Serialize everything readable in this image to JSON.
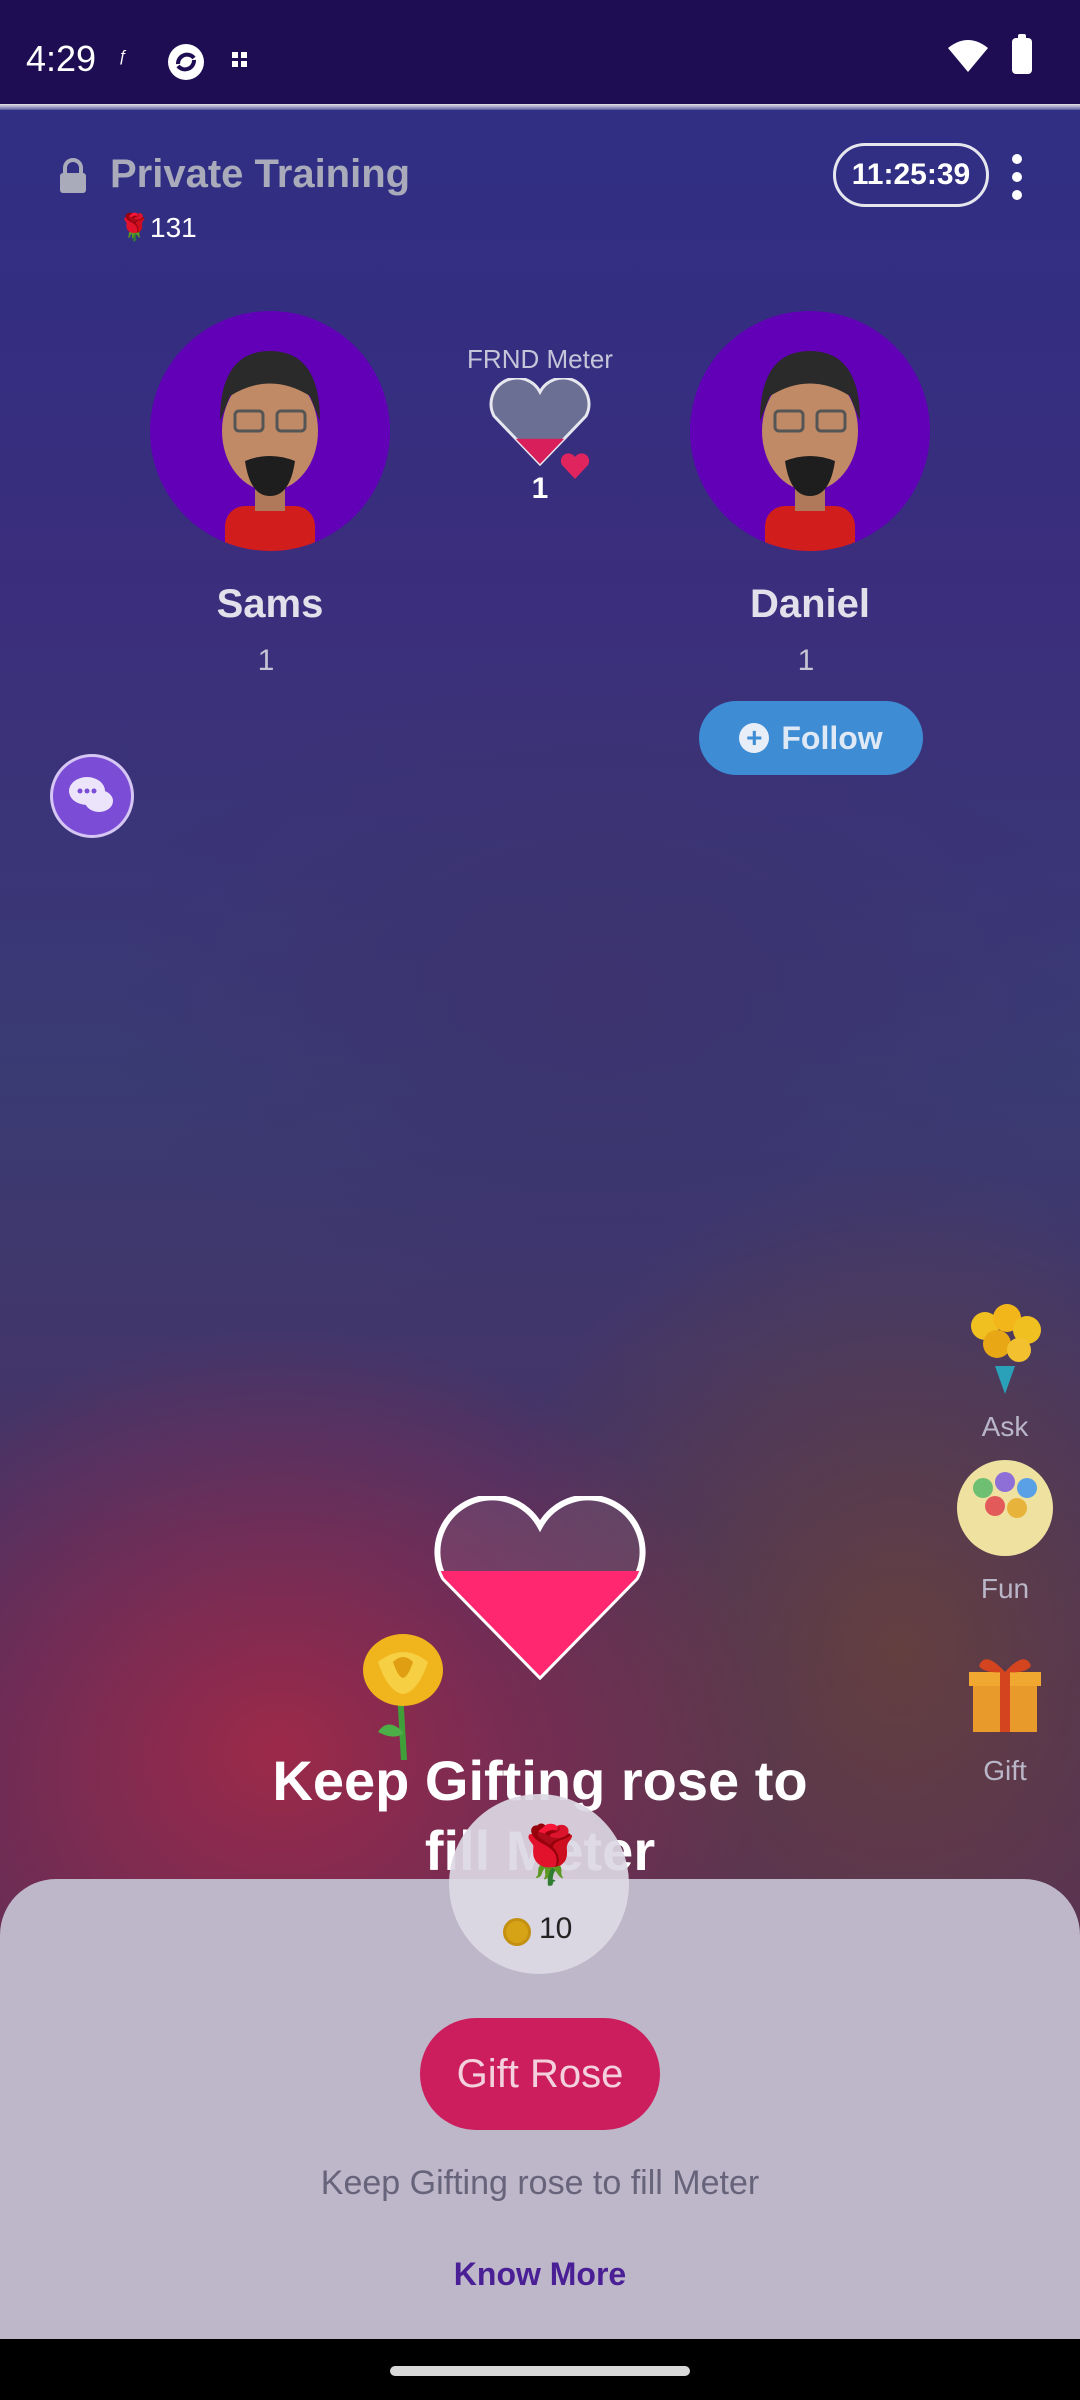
{
  "status_bar": {
    "time": "4:29",
    "notification_icons": [
      "frnd-app-icon",
      "sync-icon",
      "grid-icon"
    ]
  },
  "room": {
    "title": "Private Training",
    "rose_count": "131",
    "timer": "11:25:39"
  },
  "meter": {
    "label": "FRND Meter",
    "count": "1",
    "fill_fraction": 0.35
  },
  "users": [
    {
      "name": "Sams",
      "count": "1"
    },
    {
      "name": "Daniel",
      "count": "1",
      "follow_label": "Follow"
    }
  ],
  "side_actions": [
    {
      "label": "Ask",
      "icon": "bouquet-icon"
    },
    {
      "label": "Fun",
      "icon": "lottery-balls-icon"
    },
    {
      "label": "Gift",
      "icon": "gift-box-icon"
    }
  ],
  "promo": {
    "heading": "Keep Gifting rose to fill Meter",
    "big_heart_fill_fraction": 0.7
  },
  "sheet": {
    "rose_price": "10",
    "gift_button": "Gift Rose",
    "description": "Keep Gifting rose to fill Meter",
    "know_more": "Know More"
  },
  "colors": {
    "status_bar": "#1e0d53",
    "avatar_bg": "#6200b8",
    "follow_button": "#3d8cd4",
    "gift_button": "#cc1d5d",
    "heart_fill": "#ff2770",
    "know_more": "#4a1f96"
  }
}
